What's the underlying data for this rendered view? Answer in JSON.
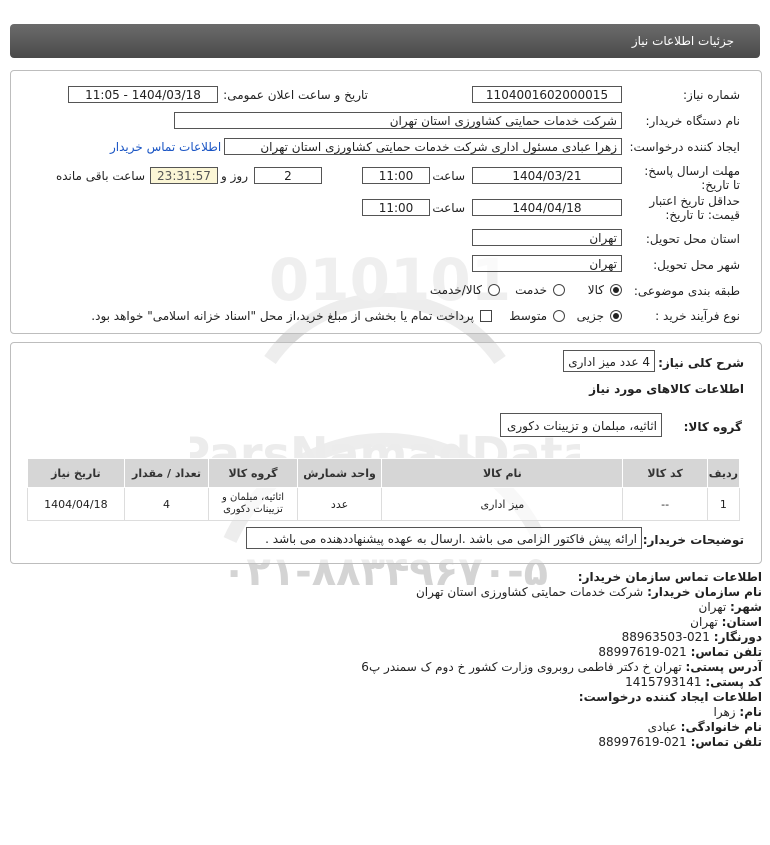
{
  "header": {
    "title": "جزئیات اطلاعات نیاز"
  },
  "form": {
    "need_number_label": "شماره نیاز:",
    "need_number": "1104001602000015",
    "announce_label": "تاریخ و ساعت اعلان عمومی:",
    "announce_value": "1404/03/18 - 11:05",
    "buyer_org_label": "نام دستگاه خریدار:",
    "buyer_org": "شرکت خدمات حمایتی کشاورزی استان تهران",
    "creator_label": "ایجاد کننده درخواست:",
    "creator": "زهرا عبادی مسئول اداری  شرکت خدمات حمایتی کشاورزی استان تهران",
    "buyer_contact_link": "اطلاعات تماس خریدار",
    "reply_deadline_label": "مهلت ارسال پاسخ: تا تاریخ:",
    "reply_date": "1404/03/21",
    "time_label": "ساعت",
    "reply_time": "11:00",
    "days_value": "2",
    "days_label": "روز و",
    "remaining_time": "23:31:57",
    "remaining_label": "ساعت باقی مانده",
    "price_validity_label": "حداقل تاریخ اعتبار قیمت: تا تاریخ:",
    "validity_date": "1404/04/18",
    "validity_time": "11:00",
    "delivery_province_label": "استان محل تحویل:",
    "delivery_province": "تهران",
    "delivery_city_label": "شهر محل تحویل:",
    "delivery_city": "تهران",
    "category_label": "طبقه بندی موضوعی:",
    "category_options": [
      "کالا",
      "خدمت",
      "کالا/خدمت"
    ],
    "category_selected": "کالا",
    "process_label": "نوع فرآیند خرید :",
    "process_options": [
      "جزیی",
      "متوسط"
    ],
    "process_selected": "جزیی",
    "payment_note": "پرداخت تمام یا بخشی از مبلغ خرید،از محل \"اسناد خزانه اسلامی\" خواهد بود."
  },
  "details": {
    "summary_label": "شرح کلی نیاز:",
    "summary": "4 عدد میز اداری",
    "goods_info_title": "اطلاعات کالاهای مورد نیاز",
    "goods_group_label": "گروه کالا:",
    "goods_group": "اثاثیه، مبلمان و تزیینات دکوری",
    "table_headers": [
      "ردیف",
      "کد کالا",
      "نام کالا",
      "واحد شمارش",
      "گروه کالا",
      "تعداد / مقدار",
      "تاریخ نیاز"
    ],
    "rows": [
      [
        "1",
        "--",
        "میز اداری",
        "عدد",
        "اثاثیه، مبلمان و تزیینات دکوری",
        "4",
        "1404/04/18"
      ]
    ],
    "buyer_notes_label": "توضیحات خریدار:",
    "buyer_notes": "ارائه پیش فاکتور الزامی می باشد .ارسال به عهده پیشنهاددهنده می باشد ."
  },
  "contact": {
    "org_title": "اطلاعات تماس سازمان خریدار:",
    "buyer_name_label": "نام سازمان خریدار:",
    "buyer_name": "شرکت خدمات حمایتی کشاورزی استان تهران",
    "city_label": "شهر:",
    "city": "تهران",
    "province_label": "استان:",
    "province": "تهران",
    "fax_label": "دورنگار:",
    "fax": "021-88963503",
    "phone_label": "تلفن تماس:",
    "phone": "021-88997619",
    "address_label": "آدرس پستی:",
    "address": "تهران خ دکتر فاطمی روبروی وزارت کشور خ دوم ک سمندر پ6",
    "postal_label": "کد پستی:",
    "postal": "1415793141",
    "creator_title": "اطلاعات ایجاد کننده درخواست:",
    "first_name_label": "نام:",
    "first_name": "زهرا",
    "last_name_label": "نام خانوادگی:",
    "last_name": "عبادی",
    "creator_phone_label": "تلفن تماس:",
    "creator_phone": "021-88997619"
  },
  "watermark": {
    "brand": "ParsNamadData",
    "phone": "۰۲۱-۸۸۳۴۹۶۷۰-۵"
  },
  "colors": {
    "title_bar": "#555555",
    "link": "#1a55c4",
    "table_header": "#d6d6d6"
  }
}
